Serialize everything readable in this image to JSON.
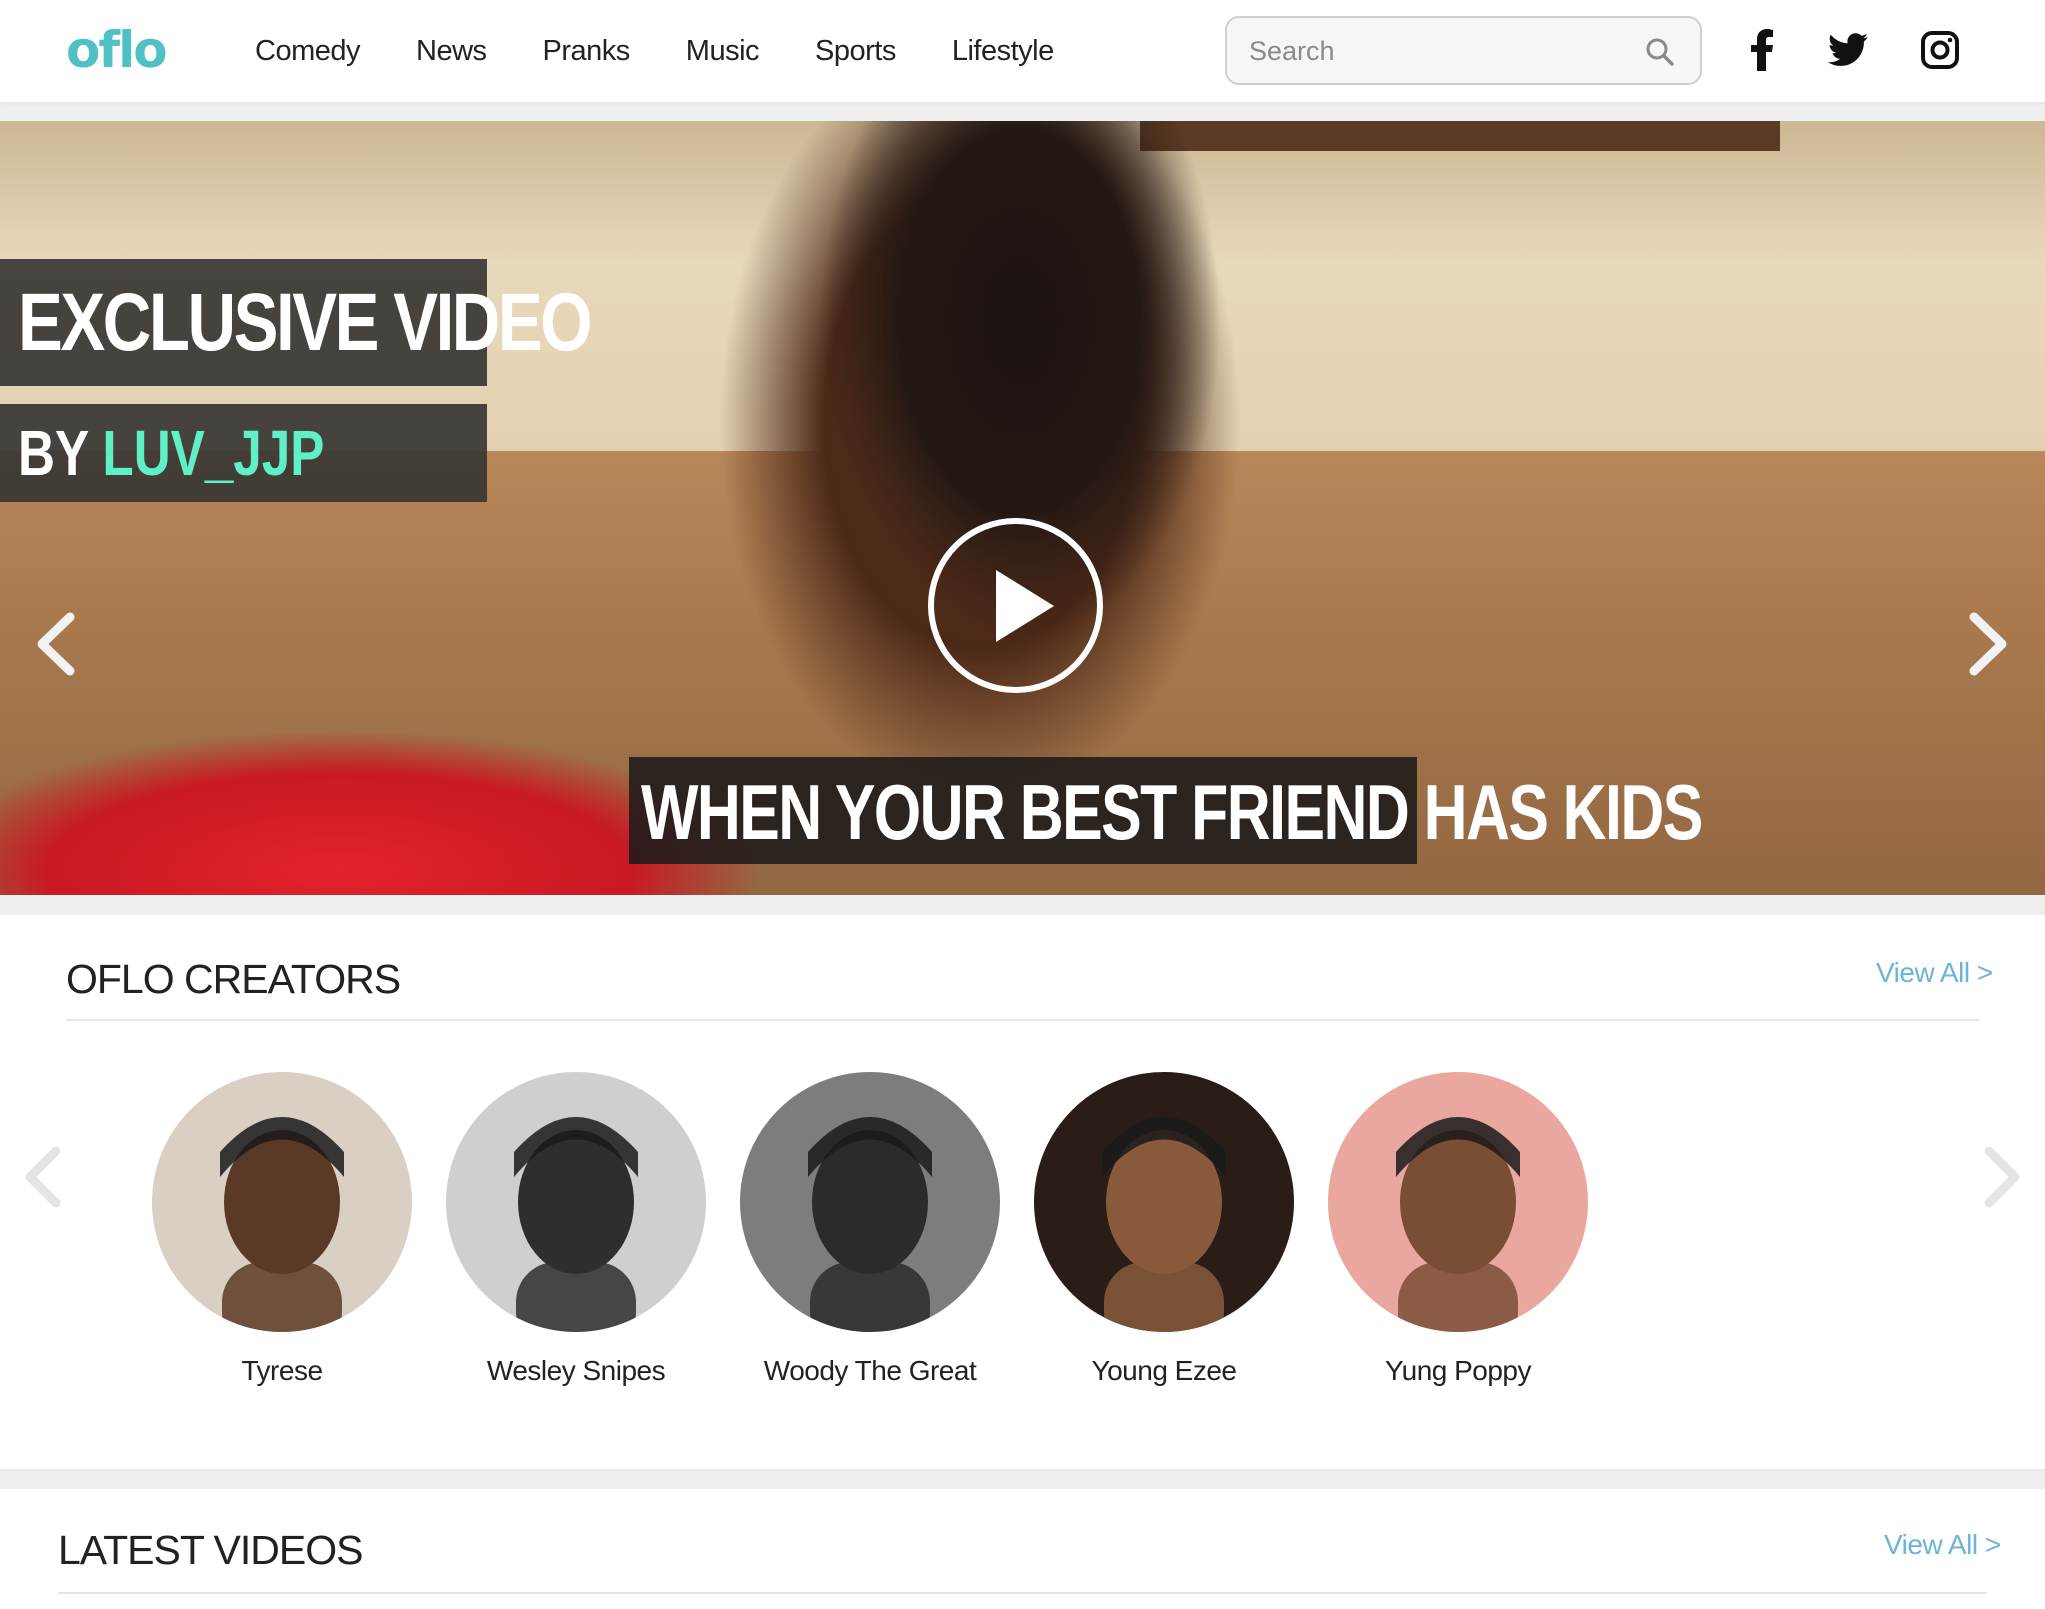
{
  "header": {
    "logo": "oflo",
    "nav": [
      "Comedy",
      "News",
      "Pranks",
      "Music",
      "Sports",
      "Lifestyle"
    ],
    "search": {
      "placeholder": "Search",
      "value": ""
    },
    "social": [
      "facebook-icon",
      "twitter-icon",
      "instagram-icon"
    ]
  },
  "hero": {
    "badge_title": "EXCLUSIVE VIDEO",
    "badge_by": "BY",
    "badge_author": "LUV_JJP",
    "caption": "WHEN YOUR BEST FRIEND HAS KIDS"
  },
  "creators": {
    "title": "OFLO CREATORS",
    "view_all": "View All >",
    "items": [
      {
        "name": "Tyrese",
        "bg": "#d9cfc2",
        "skin": "#5a3a26"
      },
      {
        "name": "Wesley Snipes",
        "bg": "#cfcfcf",
        "skin": "#2e2e2e"
      },
      {
        "name": "Woody The Great",
        "bg": "#7d7d7d",
        "skin": "#2b2b2b"
      },
      {
        "name": "Young Ezee",
        "bg": "#2a1d18",
        "skin": "#8a5a3c"
      },
      {
        "name": "Yung Poppy",
        "bg": "#e9a79f",
        "skin": "#7a4d35"
      }
    ]
  },
  "latest": {
    "title": "LATEST VIDEOS",
    "view_all": "View All >"
  },
  "colors": {
    "accent": "#5ff0c6",
    "logo": "#4fc1c4",
    "link": "#6db3d8"
  }
}
